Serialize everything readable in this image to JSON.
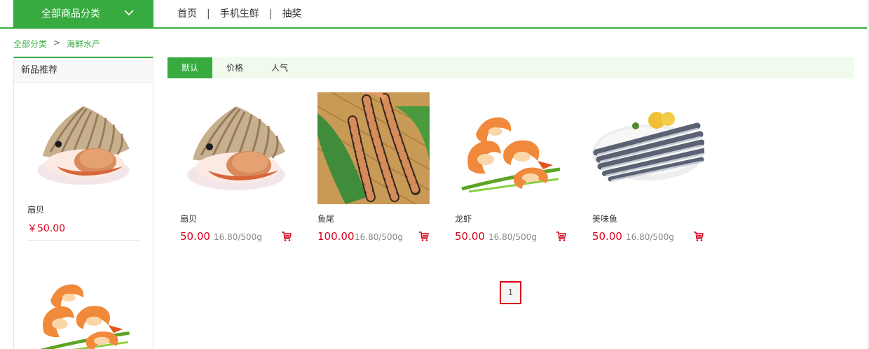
{
  "header": {
    "category_button_label": "全部商品分类",
    "nav": [
      "首页",
      "手机生鲜",
      "抽奖"
    ],
    "nav_separator": "|"
  },
  "breadcrumb": {
    "root": "全部分类",
    "arrow": ">",
    "current": "海鲜水产"
  },
  "sidebar": {
    "title": "新品推荐",
    "items": [
      {
        "name": "扇贝",
        "price": "￥50.00",
        "image": "scallop"
      },
      {
        "name": "",
        "price": "",
        "image": "shrimp"
      }
    ]
  },
  "sort_tabs": [
    {
      "label": "默认",
      "active": true
    },
    {
      "label": "价格",
      "active": false
    },
    {
      "label": "人气",
      "active": false
    }
  ],
  "products": [
    {
      "name": "扇贝",
      "price": "50.00",
      "unit_price": "16.80/500g",
      "image": "scallop"
    },
    {
      "name": "鱼尾",
      "price": "100.00",
      "unit_price": "16.80/500g",
      "image": "tiger-prawns"
    },
    {
      "name": "龙虾",
      "price": "50.00",
      "unit_price": "16.80/500g",
      "image": "shrimp"
    },
    {
      "name": "美味鱼",
      "price": "50.00",
      "unit_price": "16.80/500g",
      "image": "saury-fish"
    }
  ],
  "pagination": {
    "current_page": "1"
  },
  "colors": {
    "brand_green": "#37ab40",
    "price_red": "#d9001b",
    "sortbar_bg": "#f0fbee"
  },
  "icons": {
    "category_chevron": "chevron-down-icon",
    "cart": "cart-icon"
  }
}
